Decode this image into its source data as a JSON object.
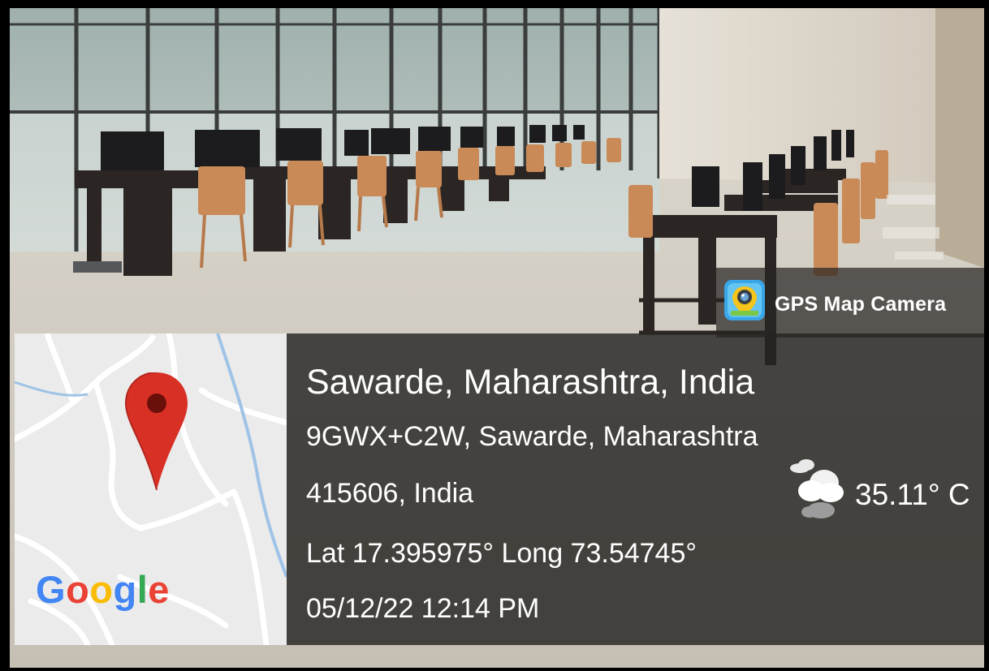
{
  "overlay": {
    "app_name": "GPS Map Camera",
    "app_icon": "gps-map-camera-icon",
    "location_title": "Sawarde, Maharashtra, India",
    "address_line1": "9GWX+C2W, Sawarde, Maharashtra",
    "address_line2": "415606, India",
    "coordinates": "Lat 17.395975° Long 73.54745°",
    "datetime": "05/12/22 12:14 PM",
    "weather_icon": "partly-cloudy-icon",
    "temperature": "35.11° C"
  },
  "map": {
    "pin_icon": "map-pin-icon",
    "pin_color": "#d93025",
    "attribution": [
      "G",
      "o",
      "o",
      "g",
      "l",
      "e"
    ],
    "attribution_colors": [
      "#4285F4",
      "#EA4335",
      "#FBBC05",
      "#4285F4",
      "#34A853",
      "#EA4335"
    ]
  },
  "colors": {
    "panel": "#2a2826",
    "text": "#ffffff"
  }
}
